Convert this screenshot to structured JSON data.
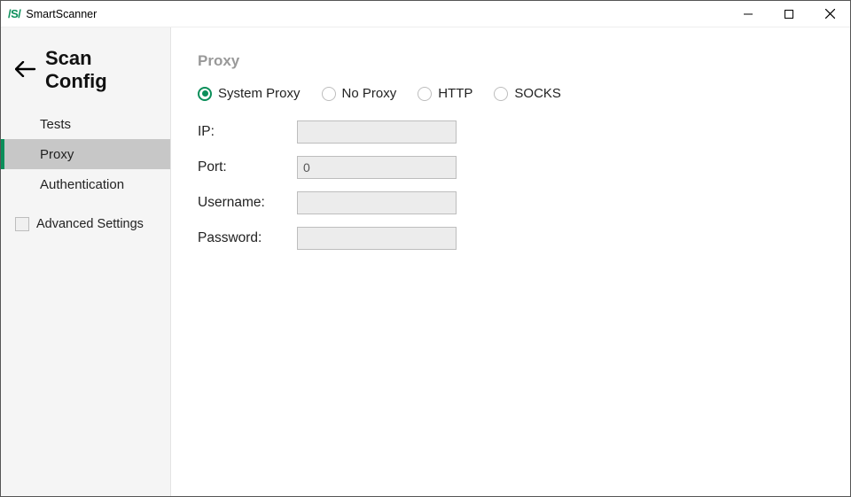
{
  "app": {
    "logo": "/S/",
    "title": "SmartScanner"
  },
  "sidebar": {
    "title": "Scan Config",
    "items": [
      {
        "label": "Tests"
      },
      {
        "label": "Proxy"
      },
      {
        "label": "Authentication"
      }
    ],
    "advanced_label": "Advanced Settings"
  },
  "main": {
    "section_title": "Proxy",
    "radio_options": [
      {
        "label": "System Proxy"
      },
      {
        "label": "No Proxy"
      },
      {
        "label": "HTTP"
      },
      {
        "label": "SOCKS"
      }
    ],
    "fields": {
      "ip_label": "IP:",
      "ip_value": "",
      "port_label": "Port:",
      "port_value": "0",
      "username_label": "Username:",
      "username_value": "",
      "password_label": "Password:",
      "password_value": ""
    }
  }
}
